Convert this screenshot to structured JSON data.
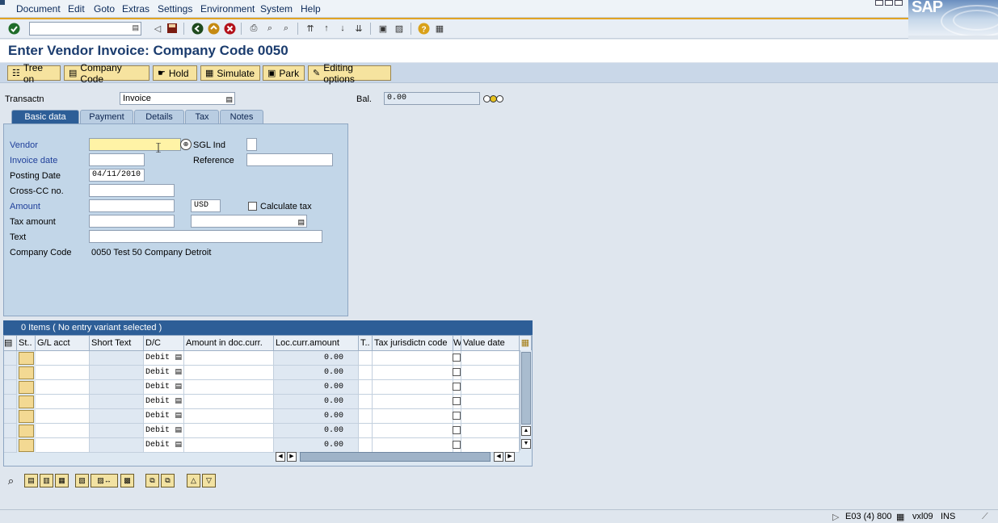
{
  "menu": [
    "Document",
    "Edit",
    "Goto",
    "Extras",
    "Settings",
    "Environment",
    "System",
    "Help"
  ],
  "brand": "SAP",
  "title": "Enter Vendor Invoice: Company Code 0050",
  "app_toolbar": {
    "tree_on": "Tree on",
    "company_code": "Company Code",
    "hold": "Hold",
    "simulate": "Simulate",
    "park": "Park",
    "editing_options": "Editing options"
  },
  "header": {
    "transaction_label": "Transactn",
    "transaction_value": "Invoice",
    "balance_label": "Bal.",
    "balance_value": "0.00"
  },
  "tabs": [
    "Basic data",
    "Payment",
    "Details",
    "Tax",
    "Notes"
  ],
  "basic": {
    "vendor_label": "Vendor",
    "vendor_value": "",
    "sgl_label": "SGL Ind",
    "invoice_date_label": "Invoice date",
    "reference_label": "Reference",
    "posting_date_label": "Posting Date",
    "posting_date_value": "04/11/2010",
    "crosscc_label": "Cross-CC no.",
    "amount_label": "Amount",
    "currency": "USD",
    "calc_tax_label": "Calculate tax",
    "tax_amount_label": "Tax amount",
    "text_label": "Text",
    "company_code_label": "Company Code",
    "company_code_value": "0050 Test 50 Company Detroit"
  },
  "items": {
    "header": "0 Items ( No entry variant selected )",
    "columns": [
      "St..",
      "G/L acct",
      "Short Text",
      "D/C",
      "Amount in doc.curr.",
      "Loc.curr.amount",
      "T..",
      "Tax jurisdictn code",
      "W..",
      "Value date"
    ],
    "rows": [
      {
        "dc": "Debit",
        "loc": "0.00"
      },
      {
        "dc": "Debit",
        "loc": "0.00"
      },
      {
        "dc": "Debit",
        "loc": "0.00"
      },
      {
        "dc": "Debit",
        "loc": "0.00"
      },
      {
        "dc": "Debit",
        "loc": "0.00"
      },
      {
        "dc": "Debit",
        "loc": "0.00"
      },
      {
        "dc": "Debit",
        "loc": "0.00"
      }
    ]
  },
  "status": {
    "system": "E03 (4) 800",
    "server": "vxl09",
    "mode": "INS"
  }
}
